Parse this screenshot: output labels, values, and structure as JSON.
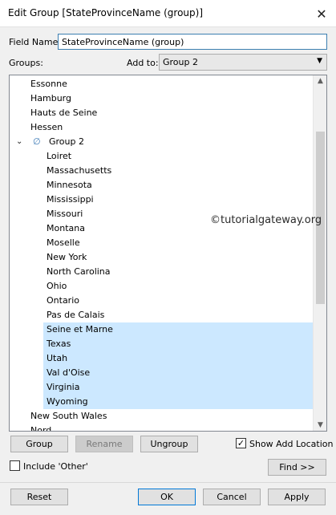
{
  "window": {
    "title": "Edit Group [StateProvinceName (group)]",
    "close_glyph": "✕"
  },
  "form": {
    "field_name_label": "Field Name:",
    "field_name_value": "StateProvinceName (group)",
    "groups_label": "Groups:",
    "add_to_label": "Add to:",
    "add_to_value": "Group 2"
  },
  "list": {
    "rows": [
      {
        "label": "Essonne",
        "level": 0,
        "selected": false
      },
      {
        "label": "Hamburg",
        "level": 0,
        "selected": false
      },
      {
        "label": "Hauts de Seine",
        "level": 0,
        "selected": false
      },
      {
        "label": "Hessen",
        "level": 0,
        "selected": false
      },
      {
        "label": "Group 2",
        "level": 0,
        "group": true,
        "expanded": true,
        "selected": false
      },
      {
        "label": "Loiret",
        "level": 1,
        "selected": false
      },
      {
        "label": "Massachusetts",
        "level": 1,
        "selected": false
      },
      {
        "label": "Minnesota",
        "level": 1,
        "selected": false
      },
      {
        "label": "Mississippi",
        "level": 1,
        "selected": false
      },
      {
        "label": "Missouri",
        "level": 1,
        "selected": false
      },
      {
        "label": "Montana",
        "level": 1,
        "selected": false
      },
      {
        "label": "Moselle",
        "level": 1,
        "selected": false
      },
      {
        "label": "New York",
        "level": 1,
        "selected": false
      },
      {
        "label": "North Carolina",
        "level": 1,
        "selected": false
      },
      {
        "label": "Ohio",
        "level": 1,
        "selected": false
      },
      {
        "label": "Ontario",
        "level": 1,
        "selected": false
      },
      {
        "label": "Pas de Calais",
        "level": 1,
        "selected": false
      },
      {
        "label": "Seine et Marne",
        "level": 1,
        "selected": true
      },
      {
        "label": "Texas",
        "level": 1,
        "selected": true
      },
      {
        "label": "Utah",
        "level": 1,
        "selected": true
      },
      {
        "label": "Val d'Oise",
        "level": 1,
        "selected": true
      },
      {
        "label": "Virginia",
        "level": 1,
        "selected": true
      },
      {
        "label": "Wyoming",
        "level": 1,
        "selected": true
      },
      {
        "label": "New South Wales",
        "level": 0,
        "selected": false
      },
      {
        "label": "Nord",
        "level": 0,
        "selected": false
      }
    ],
    "selection_color": "#cce8ff"
  },
  "watermark": "©tutorialgateway.org",
  "actions": {
    "group": "Group",
    "rename": "Rename",
    "ungroup": "Ungroup",
    "show_add_location": "Show Add Location",
    "show_add_location_checked": true,
    "include_other": "Include 'Other'",
    "include_other_checked": false,
    "find": "Find >>"
  },
  "footer": {
    "reset": "Reset",
    "ok": "OK",
    "cancel": "Cancel",
    "apply": "Apply"
  },
  "icons": {
    "chevron": "chevron-down-icon",
    "group": "paperclip-icon",
    "dropdown": "dropdown-arrow-icon"
  }
}
